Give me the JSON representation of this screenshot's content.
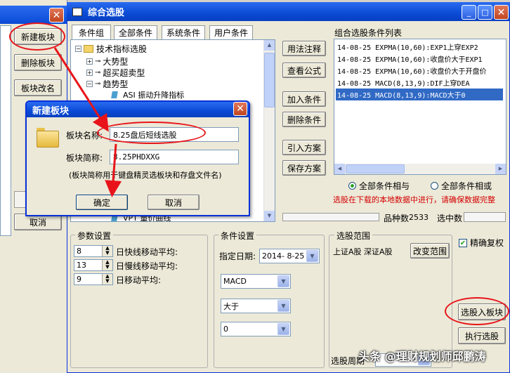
{
  "left_window": {
    "buttons": [
      "新建板块",
      "删除板块",
      "板块改名",
      "取消"
    ]
  },
  "main_window": {
    "title": "综合选股",
    "tabs": [
      "条件组",
      "全部条件",
      "系统条件",
      "用户条件"
    ],
    "tree": [
      {
        "label": "技术指标选股",
        "indent": 0,
        "icon": "folder-icon"
      },
      {
        "label": "大势型",
        "indent": 1,
        "icon": "plus-node"
      },
      {
        "label": "超买超卖型",
        "indent": 1,
        "icon": "plus-node"
      },
      {
        "label": "趋势型",
        "indent": 1,
        "icon": "minus-node"
      },
      {
        "label": "ASI 振动升降指标",
        "indent": 2,
        "icon": "indicator-icon"
      }
    ],
    "tree_bottom_item": "VPT 量价曲线",
    "action_buttons": [
      "用法注释",
      "查看公式",
      "加入条件",
      "删除条件",
      "引入方案",
      "保存方案"
    ],
    "conditions_title": "组合选股条件列表",
    "conditions": [
      "14-08-25 EXPMA(10,60):EXP1上穿EXP2",
      "14-08-25 EXPMA(10,60):收盘价大于EXP1",
      "14-08-25 EXPMA(10,60):收盘价大于开盘价",
      "14-08-25 MACD(8,13,9):DIF上穿DEA",
      "14-08-25 MACD(8,13,9):MACD大于0"
    ],
    "selected_condition_index": 4,
    "radio_and": "全部条件相与",
    "radio_or": "全部条件相或",
    "warning": "选股在下载的本地数据中进行，请确保数据完整",
    "stock_count_label": "品种数",
    "stock_count": "2533",
    "selected_count_label": "选中数",
    "params": {
      "legend": "参数设置",
      "rows": [
        {
          "value": "8",
          "label": "日快线移动平均:"
        },
        {
          "value": "13",
          "label": "日慢线移动平均:"
        },
        {
          "value": "9",
          "label": "日移动平均:"
        }
      ]
    },
    "cond_settings": {
      "legend": "条件设置",
      "date_label": "指定日期:",
      "date_value": "2014- 8-25",
      "combo1": "MACD",
      "combo2": "大于",
      "combo3": "0"
    },
    "range": {
      "legend": "选股范围",
      "markets": "上证A股 深证A股",
      "change_button": "改变范围",
      "period_label": "选股周期"
    },
    "exact_restore": "精确复权",
    "select_to_block": "选股入板块",
    "run_select": "执行选股"
  },
  "dialog": {
    "title": "新建板块",
    "name_label": "板块名称:",
    "name_value": "8.25盘后短线选股",
    "abbr_label": "板块简称:",
    "abbr_value": "8.25PHDXXG",
    "note": "(板块简称用于键盘精灵选板块和存盘文件名)",
    "ok": "确定",
    "cancel": "取消"
  },
  "watermark": "头条 @理财规划师邱鹏涛"
}
